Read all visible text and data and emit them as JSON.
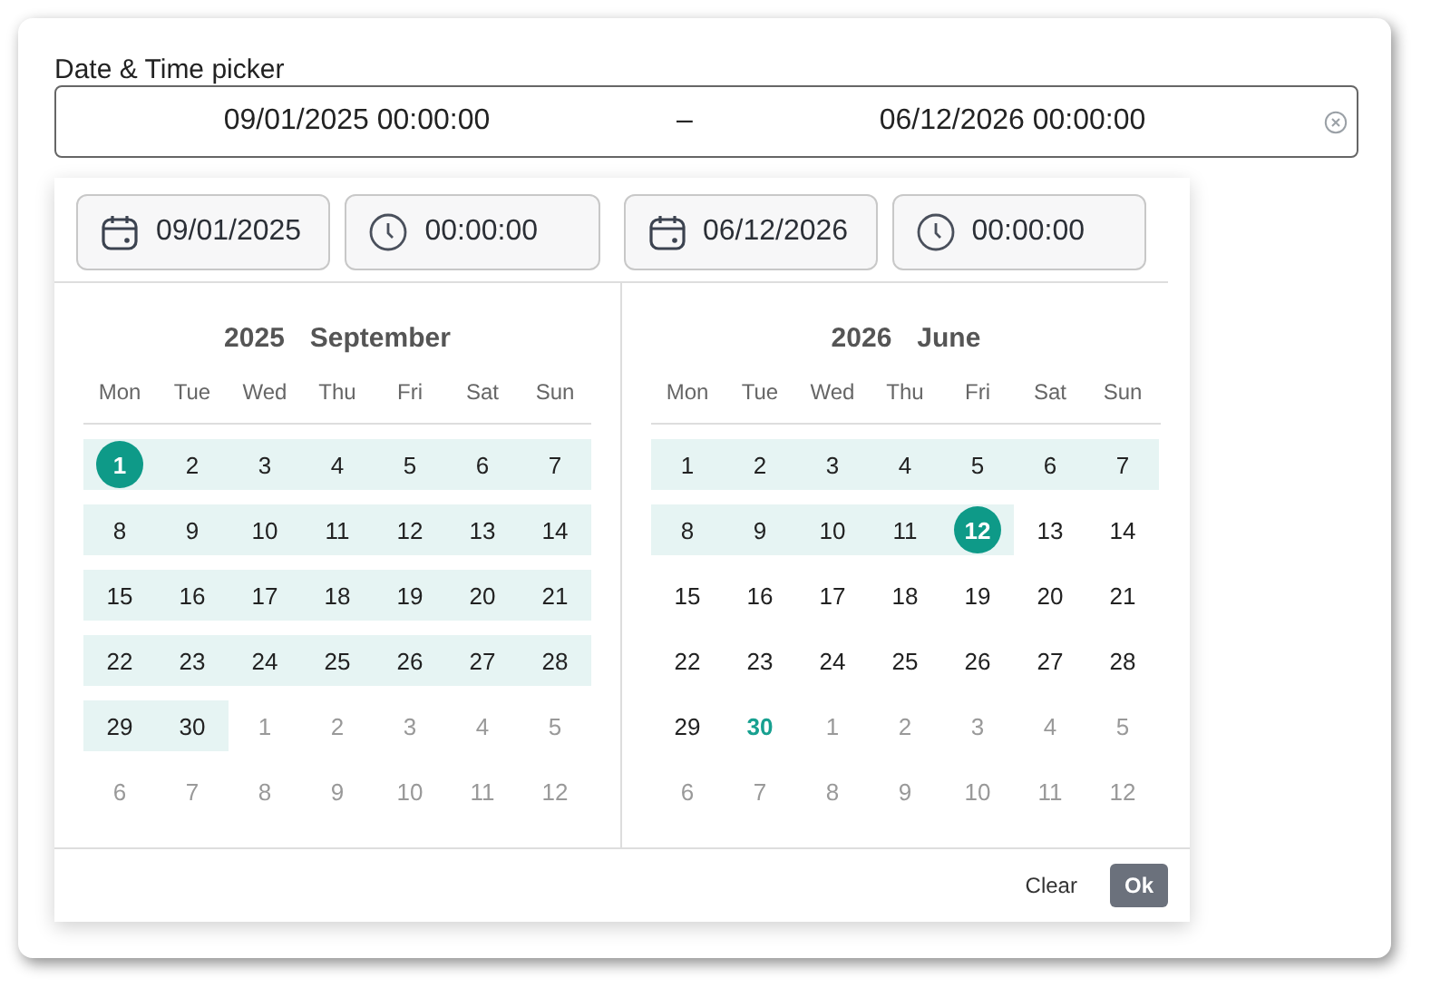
{
  "label": "Date & Time picker",
  "range_input": {
    "start": "09/01/2025 00:00:00",
    "separator": "–",
    "end": "06/12/2026 00:00:00"
  },
  "fields": [
    {
      "kind": "date",
      "value": "09/01/2025"
    },
    {
      "kind": "time",
      "value": "00:00:00"
    },
    {
      "kind": "date",
      "value": "06/12/2026"
    },
    {
      "kind": "time",
      "value": "00:00:00"
    }
  ],
  "calendars": [
    {
      "year": "2025",
      "month": "September",
      "weekdays": [
        "Mon",
        "Tue",
        "Wed",
        "Thu",
        "Fri",
        "Sat",
        "Sun"
      ],
      "weeks": [
        [
          {
            "d": "1",
            "muted": false,
            "in_range": true,
            "selected": true,
            "today": false
          },
          {
            "d": "2",
            "muted": false,
            "in_range": true,
            "selected": false,
            "today": false
          },
          {
            "d": "3",
            "muted": false,
            "in_range": true,
            "selected": false,
            "today": false
          },
          {
            "d": "4",
            "muted": false,
            "in_range": true,
            "selected": false,
            "today": false
          },
          {
            "d": "5",
            "muted": false,
            "in_range": true,
            "selected": false,
            "today": false
          },
          {
            "d": "6",
            "muted": false,
            "in_range": true,
            "selected": false,
            "today": false
          },
          {
            "d": "7",
            "muted": false,
            "in_range": true,
            "selected": false,
            "today": false
          }
        ],
        [
          {
            "d": "8",
            "muted": false,
            "in_range": true,
            "selected": false,
            "today": false
          },
          {
            "d": "9",
            "muted": false,
            "in_range": true,
            "selected": false,
            "today": false
          },
          {
            "d": "10",
            "muted": false,
            "in_range": true,
            "selected": false,
            "today": false
          },
          {
            "d": "11",
            "muted": false,
            "in_range": true,
            "selected": false,
            "today": false
          },
          {
            "d": "12",
            "muted": false,
            "in_range": true,
            "selected": false,
            "today": false
          },
          {
            "d": "13",
            "muted": false,
            "in_range": true,
            "selected": false,
            "today": false
          },
          {
            "d": "14",
            "muted": false,
            "in_range": true,
            "selected": false,
            "today": false
          }
        ],
        [
          {
            "d": "15",
            "muted": false,
            "in_range": true,
            "selected": false,
            "today": false
          },
          {
            "d": "16",
            "muted": false,
            "in_range": true,
            "selected": false,
            "today": false
          },
          {
            "d": "17",
            "muted": false,
            "in_range": true,
            "selected": false,
            "today": false
          },
          {
            "d": "18",
            "muted": false,
            "in_range": true,
            "selected": false,
            "today": false
          },
          {
            "d": "19",
            "muted": false,
            "in_range": true,
            "selected": false,
            "today": false
          },
          {
            "d": "20",
            "muted": false,
            "in_range": true,
            "selected": false,
            "today": false
          },
          {
            "d": "21",
            "muted": false,
            "in_range": true,
            "selected": false,
            "today": false
          }
        ],
        [
          {
            "d": "22",
            "muted": false,
            "in_range": true,
            "selected": false,
            "today": false
          },
          {
            "d": "23",
            "muted": false,
            "in_range": true,
            "selected": false,
            "today": false
          },
          {
            "d": "24",
            "muted": false,
            "in_range": true,
            "selected": false,
            "today": false
          },
          {
            "d": "25",
            "muted": false,
            "in_range": true,
            "selected": false,
            "today": false
          },
          {
            "d": "26",
            "muted": false,
            "in_range": true,
            "selected": false,
            "today": false
          },
          {
            "d": "27",
            "muted": false,
            "in_range": true,
            "selected": false,
            "today": false
          },
          {
            "d": "28",
            "muted": false,
            "in_range": true,
            "selected": false,
            "today": false
          }
        ],
        [
          {
            "d": "29",
            "muted": false,
            "in_range": true,
            "selected": false,
            "today": false
          },
          {
            "d": "30",
            "muted": false,
            "in_range": true,
            "selected": false,
            "today": false
          },
          {
            "d": "1",
            "muted": true,
            "in_range": false,
            "selected": false,
            "today": false
          },
          {
            "d": "2",
            "muted": true,
            "in_range": false,
            "selected": false,
            "today": false
          },
          {
            "d": "3",
            "muted": true,
            "in_range": false,
            "selected": false,
            "today": false
          },
          {
            "d": "4",
            "muted": true,
            "in_range": false,
            "selected": false,
            "today": false
          },
          {
            "d": "5",
            "muted": true,
            "in_range": false,
            "selected": false,
            "today": false
          }
        ],
        [
          {
            "d": "6",
            "muted": true,
            "in_range": false,
            "selected": false,
            "today": false
          },
          {
            "d": "7",
            "muted": true,
            "in_range": false,
            "selected": false,
            "today": false
          },
          {
            "d": "8",
            "muted": true,
            "in_range": false,
            "selected": false,
            "today": false
          },
          {
            "d": "9",
            "muted": true,
            "in_range": false,
            "selected": false,
            "today": false
          },
          {
            "d": "10",
            "muted": true,
            "in_range": false,
            "selected": false,
            "today": false
          },
          {
            "d": "11",
            "muted": true,
            "in_range": false,
            "selected": false,
            "today": false
          },
          {
            "d": "12",
            "muted": true,
            "in_range": false,
            "selected": false,
            "today": false
          }
        ]
      ]
    },
    {
      "year": "2026",
      "month": "June",
      "weekdays": [
        "Mon",
        "Tue",
        "Wed",
        "Thu",
        "Fri",
        "Sat",
        "Sun"
      ],
      "weeks": [
        [
          {
            "d": "1",
            "muted": false,
            "in_range": true,
            "selected": false,
            "today": false
          },
          {
            "d": "2",
            "muted": false,
            "in_range": true,
            "selected": false,
            "today": false
          },
          {
            "d": "3",
            "muted": false,
            "in_range": true,
            "selected": false,
            "today": false
          },
          {
            "d": "4",
            "muted": false,
            "in_range": true,
            "selected": false,
            "today": false
          },
          {
            "d": "5",
            "muted": false,
            "in_range": true,
            "selected": false,
            "today": false
          },
          {
            "d": "6",
            "muted": false,
            "in_range": true,
            "selected": false,
            "today": false
          },
          {
            "d": "7",
            "muted": false,
            "in_range": true,
            "selected": false,
            "today": false
          }
        ],
        [
          {
            "d": "8",
            "muted": false,
            "in_range": true,
            "selected": false,
            "today": false
          },
          {
            "d": "9",
            "muted": false,
            "in_range": true,
            "selected": false,
            "today": false
          },
          {
            "d": "10",
            "muted": false,
            "in_range": true,
            "selected": false,
            "today": false
          },
          {
            "d": "11",
            "muted": false,
            "in_range": true,
            "selected": false,
            "today": false
          },
          {
            "d": "12",
            "muted": false,
            "in_range": true,
            "selected": true,
            "today": false
          },
          {
            "d": "13",
            "muted": false,
            "in_range": false,
            "selected": false,
            "today": false
          },
          {
            "d": "14",
            "muted": false,
            "in_range": false,
            "selected": false,
            "today": false
          }
        ],
        [
          {
            "d": "15",
            "muted": false,
            "in_range": false,
            "selected": false,
            "today": false
          },
          {
            "d": "16",
            "muted": false,
            "in_range": false,
            "selected": false,
            "today": false
          },
          {
            "d": "17",
            "muted": false,
            "in_range": false,
            "selected": false,
            "today": false
          },
          {
            "d": "18",
            "muted": false,
            "in_range": false,
            "selected": false,
            "today": false
          },
          {
            "d": "19",
            "muted": false,
            "in_range": false,
            "selected": false,
            "today": false
          },
          {
            "d": "20",
            "muted": false,
            "in_range": false,
            "selected": false,
            "today": false
          },
          {
            "d": "21",
            "muted": false,
            "in_range": false,
            "selected": false,
            "today": false
          }
        ],
        [
          {
            "d": "22",
            "muted": false,
            "in_range": false,
            "selected": false,
            "today": false
          },
          {
            "d": "23",
            "muted": false,
            "in_range": false,
            "selected": false,
            "today": false
          },
          {
            "d": "24",
            "muted": false,
            "in_range": false,
            "selected": false,
            "today": false
          },
          {
            "d": "25",
            "muted": false,
            "in_range": false,
            "selected": false,
            "today": false
          },
          {
            "d": "26",
            "muted": false,
            "in_range": false,
            "selected": false,
            "today": false
          },
          {
            "d": "27",
            "muted": false,
            "in_range": false,
            "selected": false,
            "today": false
          },
          {
            "d": "28",
            "muted": false,
            "in_range": false,
            "selected": false,
            "today": false
          }
        ],
        [
          {
            "d": "29",
            "muted": false,
            "in_range": false,
            "selected": false,
            "today": false
          },
          {
            "d": "30",
            "muted": false,
            "in_range": false,
            "selected": false,
            "today": true
          },
          {
            "d": "1",
            "muted": true,
            "in_range": false,
            "selected": false,
            "today": false
          },
          {
            "d": "2",
            "muted": true,
            "in_range": false,
            "selected": false,
            "today": false
          },
          {
            "d": "3",
            "muted": true,
            "in_range": false,
            "selected": false,
            "today": false
          },
          {
            "d": "4",
            "muted": true,
            "in_range": false,
            "selected": false,
            "today": false
          },
          {
            "d": "5",
            "muted": true,
            "in_range": false,
            "selected": false,
            "today": false
          }
        ],
        [
          {
            "d": "6",
            "muted": true,
            "in_range": false,
            "selected": false,
            "today": false
          },
          {
            "d": "7",
            "muted": true,
            "in_range": false,
            "selected": false,
            "today": false
          },
          {
            "d": "8",
            "muted": true,
            "in_range": false,
            "selected": false,
            "today": false
          },
          {
            "d": "9",
            "muted": true,
            "in_range": false,
            "selected": false,
            "today": false
          },
          {
            "d": "10",
            "muted": true,
            "in_range": false,
            "selected": false,
            "today": false
          },
          {
            "d": "11",
            "muted": true,
            "in_range": false,
            "selected": false,
            "today": false
          },
          {
            "d": "12",
            "muted": true,
            "in_range": false,
            "selected": false,
            "today": false
          }
        ]
      ]
    }
  ],
  "footer": {
    "clear": "Clear",
    "ok": "Ok"
  }
}
